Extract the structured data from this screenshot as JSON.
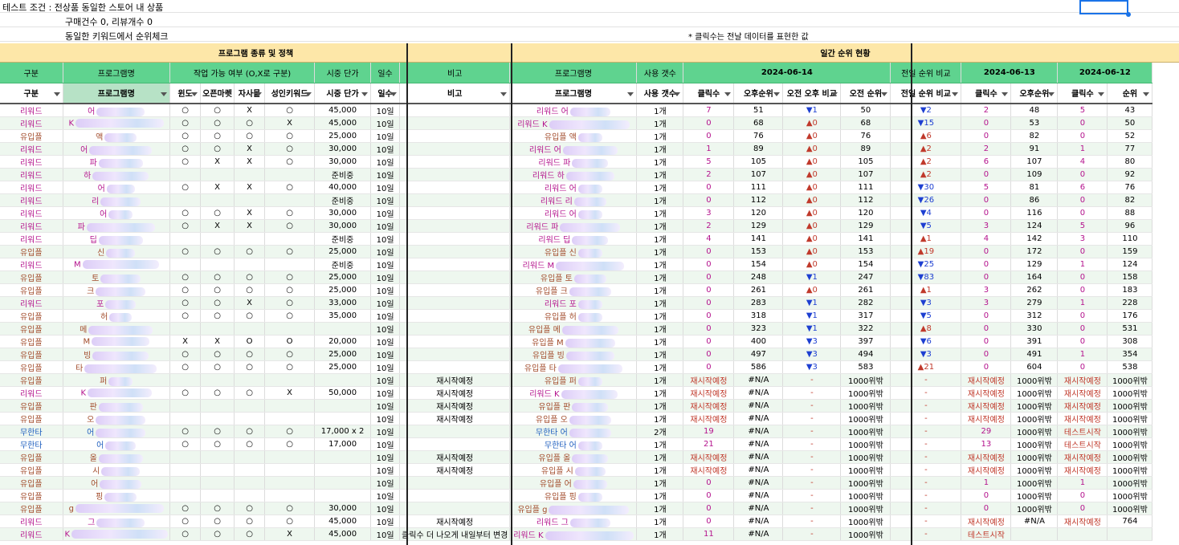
{
  "info": {
    "line1": "테스트 조건 : 전상품 동일한 스토어 내 상품",
    "line2": "구매건수 0, 리뷰개수 0",
    "line3": "동일한 키워드에서 순위체크",
    "note": "* 클릭수는 전날 데이터를 표현한 값"
  },
  "bands": {
    "left": "프로그램 종류 및 정책",
    "right": "일간 순위 현황"
  },
  "colors": {
    "header_green": "#5fd38f",
    "band_yellow": "#fde7a8",
    "up_red": "#c0392b",
    "down_blue": "#1d3fd1"
  },
  "header1": [
    "구분",
    "프로그램명",
    "작업 가능 여부 (O,X로 구분)",
    "시중 단가",
    "일수",
    "비고",
    "프로그램명",
    "사용 갯수",
    "2024-06-14",
    "전일 순위 비교",
    "2024-06-13",
    "2024-06-12"
  ],
  "header2": [
    "구분",
    "프로그램명",
    "윈도",
    "오픈마켓",
    "자사몰",
    "성인키워드",
    "시중 단가",
    "일수",
    "비고",
    "프로그램명",
    "사용 갯수",
    "클릭수",
    "오후순위",
    "오전 오후 비교",
    "오전 순위",
    "전일 순위 비교",
    "클릭수",
    "오후순위",
    "클릭수",
    "순위"
  ],
  "rows": [
    [
      "리워드",
      "어",
      "○",
      "○",
      "X",
      "○",
      "45,000",
      "10일",
      "",
      "리워드 어",
      "1개",
      "7",
      "51",
      "▼1",
      "50",
      "▼2",
      "2",
      "48",
      "5",
      "43"
    ],
    [
      "리워드",
      "K",
      "○",
      "○",
      "○",
      "X",
      "45,000",
      "10일",
      "",
      "리워드 K",
      "1개",
      "0",
      "68",
      "▲0",
      "68",
      "▼15",
      "0",
      "53",
      "0",
      "50"
    ],
    [
      "유입플",
      "액",
      "○",
      "○",
      "○",
      "○",
      "25,000",
      "10일",
      "",
      "유입플 액",
      "1개",
      "0",
      "76",
      "▲0",
      "76",
      "▲6",
      "0",
      "82",
      "0",
      "52"
    ],
    [
      "리워드",
      "어",
      "○",
      "○",
      "X",
      "○",
      "30,000",
      "10일",
      "",
      "리워드 어",
      "1개",
      "1",
      "89",
      "▲0",
      "89",
      "▲2",
      "2",
      "91",
      "1",
      "77"
    ],
    [
      "리워드",
      "파",
      "○",
      "X",
      "X",
      "○",
      "30,000",
      "10일",
      "",
      "리워드 파",
      "1개",
      "5",
      "105",
      "▲0",
      "105",
      "▲2",
      "6",
      "107",
      "4",
      "80"
    ],
    [
      "리워드",
      "하",
      "",
      "",
      "",
      "",
      "준비중",
      "10일",
      "",
      "리워드 하",
      "1개",
      "2",
      "107",
      "▲0",
      "107",
      "▲2",
      "0",
      "109",
      "0",
      "92"
    ],
    [
      "리워드",
      "어",
      "○",
      "X",
      "X",
      "○",
      "40,000",
      "10일",
      "",
      "리워드 어",
      "1개",
      "0",
      "111",
      "▲0",
      "111",
      "▼30",
      "5",
      "81",
      "6",
      "76"
    ],
    [
      "리워드",
      "리",
      "",
      "",
      "",
      "",
      "준비중",
      "10일",
      "",
      "리워드 리",
      "1개",
      "0",
      "112",
      "▲0",
      "112",
      "▼26",
      "0",
      "86",
      "0",
      "82"
    ],
    [
      "리워드",
      "어",
      "○",
      "○",
      "X",
      "○",
      "30,000",
      "10일",
      "",
      "리워드 어",
      "1개",
      "3",
      "120",
      "▲0",
      "120",
      "▼4",
      "0",
      "116",
      "0",
      "88"
    ],
    [
      "리워드",
      "파",
      "○",
      "X",
      "X",
      "○",
      "30,000",
      "10일",
      "",
      "리워드 파",
      "1개",
      "2",
      "129",
      "▲0",
      "129",
      "▼5",
      "3",
      "124",
      "5",
      "96"
    ],
    [
      "리워드",
      "딥",
      "",
      "",
      "",
      "",
      "준비중",
      "10일",
      "",
      "리워드 딥",
      "1개",
      "4",
      "141",
      "▲0",
      "141",
      "▲1",
      "4",
      "142",
      "3",
      "110"
    ],
    [
      "유입플",
      "신",
      "○",
      "○",
      "○",
      "○",
      "25,000",
      "10일",
      "",
      "유입플 신",
      "1개",
      "0",
      "153",
      "▲0",
      "153",
      "▲19",
      "0",
      "172",
      "0",
      "159"
    ],
    [
      "리워드",
      "M",
      "",
      "",
      "",
      "",
      "준비중",
      "10일",
      "",
      "리워드 M",
      "1개",
      "0",
      "154",
      "▲0",
      "154",
      "▼25",
      "0",
      "129",
      "1",
      "124"
    ],
    [
      "유입플",
      "토",
      "○",
      "○",
      "○",
      "○",
      "25,000",
      "10일",
      "",
      "유입플 토",
      "1개",
      "0",
      "248",
      "▼1",
      "247",
      "▼83",
      "0",
      "164",
      "0",
      "158"
    ],
    [
      "유입플",
      "크",
      "○",
      "○",
      "○",
      "○",
      "25,000",
      "10일",
      "",
      "유입플 크",
      "1개",
      "0",
      "261",
      "▲0",
      "261",
      "▲1",
      "3",
      "262",
      "0",
      "183"
    ],
    [
      "리워드",
      "포",
      "○",
      "○",
      "X",
      "○",
      "33,000",
      "10일",
      "",
      "리워드 포",
      "1개",
      "0",
      "283",
      "▼1",
      "282",
      "▼3",
      "3",
      "279",
      "1",
      "228"
    ],
    [
      "유입플",
      "허",
      "○",
      "○",
      "○",
      "○",
      "35,000",
      "10일",
      "",
      "유입플 허",
      "1개",
      "0",
      "318",
      "▼1",
      "317",
      "▼5",
      "0",
      "312",
      "0",
      "176"
    ],
    [
      "유입플",
      "메",
      "",
      "",
      "",
      "",
      "",
      "10일",
      "",
      "유입플 메",
      "1개",
      "0",
      "323",
      "▼1",
      "322",
      "▲8",
      "0",
      "330",
      "0",
      "531"
    ],
    [
      "유입플",
      "M",
      "X",
      "X",
      "O",
      "O",
      "20,000",
      "10일",
      "",
      "유입플 M",
      "1개",
      "0",
      "400",
      "▼3",
      "397",
      "▼6",
      "0",
      "391",
      "0",
      "308"
    ],
    [
      "유입플",
      "빙",
      "○",
      "○",
      "○",
      "○",
      "25,000",
      "10일",
      "",
      "유입플 빙",
      "1개",
      "0",
      "497",
      "▼3",
      "494",
      "▼3",
      "0",
      "491",
      "1",
      "354"
    ],
    [
      "유입플",
      "타",
      "○",
      "○",
      "○",
      "○",
      "25,000",
      "10일",
      "",
      "유입플 타",
      "1개",
      "0",
      "586",
      "▼3",
      "583",
      "▲21",
      "0",
      "604",
      "0",
      "538"
    ],
    [
      "유입플",
      "퍼",
      "",
      "",
      "",
      "",
      "",
      "10일",
      "재시작예정",
      "유입플 퍼",
      "1개",
      "재시작예정",
      "#N/A",
      "-",
      "1000위밖",
      "-",
      "재시작예정",
      "1000위밖",
      "재시작예정",
      "1000위밖"
    ],
    [
      "리워드",
      "K",
      "○",
      "○",
      "○",
      "X",
      "50,000",
      "10일",
      "재시작예정",
      "리워드 K",
      "1개",
      "재시작예정",
      "#N/A",
      "-",
      "1000위밖",
      "-",
      "재시작예정",
      "1000위밖",
      "재시작예정",
      "1000위밖"
    ],
    [
      "유입플",
      "판",
      "",
      "",
      "",
      "",
      "",
      "10일",
      "재시작예정",
      "유입플 판",
      "1개",
      "재시작예정",
      "#N/A",
      "-",
      "1000위밖",
      "-",
      "재시작예정",
      "1000위밖",
      "재시작예정",
      "1000위밖"
    ],
    [
      "유입플",
      "오",
      "",
      "",
      "",
      "",
      "",
      "10일",
      "재시작예정",
      "유입플 오",
      "1개",
      "재시작예정",
      "#N/A",
      "-",
      "1000위밖",
      "-",
      "재시작예정",
      "1000위밖",
      "재시작예정",
      "1000위밖"
    ],
    [
      "무한타",
      "어",
      "○",
      "○",
      "○",
      "○",
      "17,000 x 2",
      "10일",
      "",
      "무한타 어",
      "2개",
      "19",
      "#N/A",
      "-",
      "1000위밖",
      "-",
      "29",
      "1000위밖",
      "테스트시작",
      "1000위밖"
    ],
    [
      "무한타",
      "어",
      "○",
      "○",
      "○",
      "○",
      "17,000",
      "10일",
      "",
      "무한타 어",
      "1개",
      "21",
      "#N/A",
      "-",
      "1000위밖",
      "-",
      "13",
      "1000위밖",
      "테스트시작",
      "1000위밖"
    ],
    [
      "유입플",
      "올",
      "",
      "",
      "",
      "",
      "",
      "10일",
      "재시작예정",
      "유입플 올",
      "1개",
      "재시작예정",
      "#N/A",
      "-",
      "1000위밖",
      "-",
      "재시작예정",
      "1000위밖",
      "재시작예정",
      "1000위밖"
    ],
    [
      "유입플",
      "시",
      "",
      "",
      "",
      "",
      "",
      "10일",
      "재시작예정",
      "유입플 시",
      "1개",
      "재시작예정",
      "#N/A",
      "-",
      "1000위밖",
      "-",
      "재시작예정",
      "1000위밖",
      "재시작예정",
      "1000위밖"
    ],
    [
      "유입플",
      "어",
      "",
      "",
      "",
      "",
      "",
      "10일",
      "",
      "유입플 어",
      "1개",
      "0",
      "#N/A",
      "-",
      "1000위밖",
      "-",
      "1",
      "1000위밖",
      "1",
      "1000위밖"
    ],
    [
      "유입플",
      "핑",
      "",
      "",
      "",
      "",
      "",
      "10일",
      "",
      "유입플 핑",
      "1개",
      "0",
      "#N/A",
      "-",
      "1000위밖",
      "-",
      "0",
      "1000위밖",
      "0",
      "1000위밖"
    ],
    [
      "유입플",
      "g",
      "○",
      "○",
      "○",
      "○",
      "30,000",
      "10일",
      "",
      "유입플 g",
      "1개",
      "0",
      "#N/A",
      "-",
      "1000위밖",
      "-",
      "0",
      "1000위밖",
      "0",
      "1000위밖"
    ],
    [
      "리워드",
      "그",
      "○",
      "○",
      "○",
      "○",
      "45,000",
      "10일",
      "재시작예정",
      "리워드 그",
      "1개",
      "0",
      "#N/A",
      "-",
      "1000위밖",
      "-",
      "재시작예정",
      "#N/A",
      "재시작예정",
      "764"
    ],
    [
      "리워드",
      "K",
      "○",
      "○",
      "○",
      "X",
      "45,000",
      "10일",
      "클릭수 더 나오게 내일부터 변경",
      "리워드 K",
      "1개",
      "11",
      "#N/A",
      "-",
      "1000위밖",
      "-",
      "테스트시작",
      "",
      "",
      ""
    ]
  ]
}
